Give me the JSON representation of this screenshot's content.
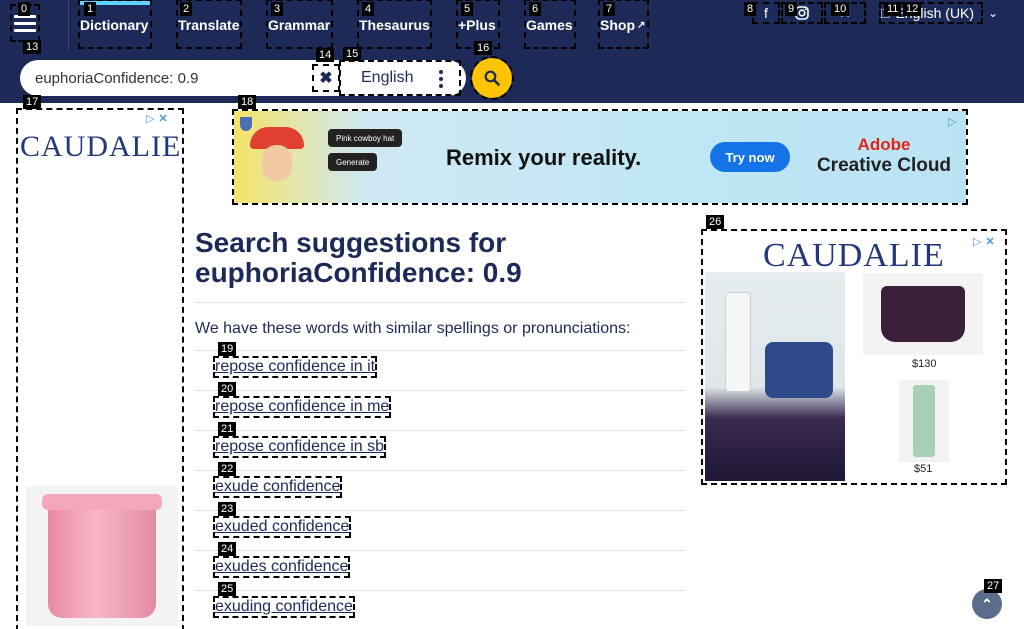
{
  "nav": {
    "items": [
      {
        "label": "Dictionary",
        "active": true
      },
      {
        "label": "Translate"
      },
      {
        "label": "Grammar"
      },
      {
        "label": "Thesaurus"
      },
      {
        "label": "+Plus"
      },
      {
        "label": "Games"
      },
      {
        "label": "Shop"
      }
    ],
    "social": [
      "facebook-icon",
      "instagram-icon",
      "x-icon"
    ],
    "language_label": "English (UK)"
  },
  "search": {
    "value": "euphoriaConfidence: 0.9",
    "dictionary_label": "English"
  },
  "ads": {
    "left_brand": "CAUDALIE",
    "banner": {
      "chip1": "Pink cowboy hat",
      "chip2": "Generate",
      "headline": "Remix your reality.",
      "cta": "Try now",
      "brand_line1": "Adobe",
      "brand_line2": "Creative Cloud"
    },
    "right_brand": "CAUDALIE",
    "right_prices": [
      "$130",
      "$51"
    ]
  },
  "main": {
    "heading_prefix": "Search suggestions for",
    "heading_query": "euphoriaConfidence: 0.9",
    "intro": "We have these words with similar spellings or pronunciations:",
    "suggestions": [
      "repose confidence in it",
      "repose confidence in me",
      "repose confidence in sb",
      "exude confidence",
      "exuded confidence",
      "exudes confidence",
      "exuding confidence"
    ]
  },
  "tags": [
    "0",
    "1",
    "2",
    "3",
    "4",
    "5",
    "6",
    "7",
    "8",
    "9",
    "10",
    "11",
    "12",
    "13",
    "14",
    "15",
    "16",
    "17",
    "18",
    "19",
    "20",
    "21",
    "22",
    "23",
    "24",
    "25",
    "26",
    "27"
  ],
  "colors": {
    "nav_bg": "#1d2a57",
    "accent_yellow": "#fec400",
    "text_navy": "#1d2a57"
  }
}
